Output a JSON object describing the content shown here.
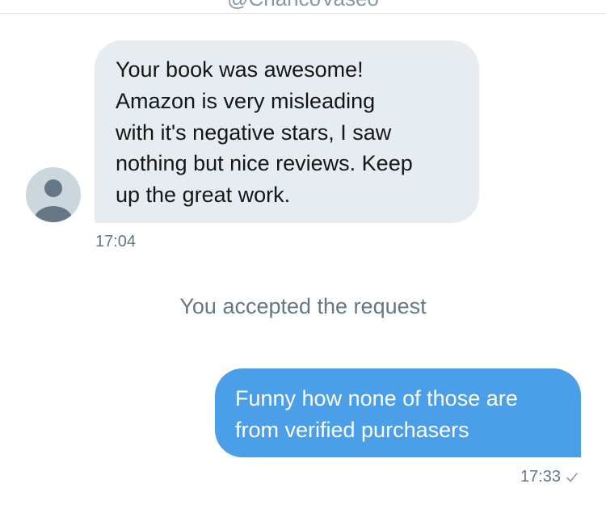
{
  "header": {
    "handle": "@ChancoVaseo"
  },
  "conversation": {
    "incoming": {
      "text": "Your book was awesome!\nAmazon is very misleading\nwith it's negative stars, I saw\nnothing but nice reviews. Keep\nup the great work.",
      "time": "17:04"
    },
    "system_message": "You accepted the request",
    "outgoing": {
      "text": "Funny how none of those are\nfrom verified purchasers",
      "time": "17:33",
      "status_icon": "checkmark-icon"
    }
  },
  "colors": {
    "incoming_bubble": "#e6ecf0",
    "outgoing_bubble": "#4a9fe8",
    "meta_text": "#657786",
    "avatar_bg": "#ccd6dd",
    "avatar_figure": "#657786"
  }
}
